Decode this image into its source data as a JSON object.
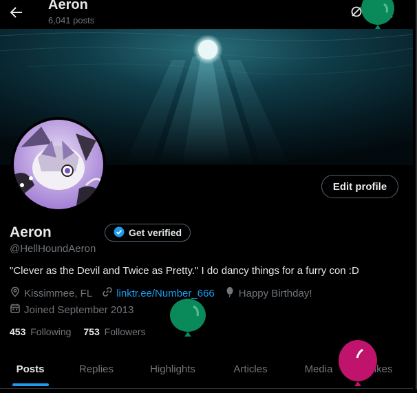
{
  "header": {
    "title": "Aeron",
    "post_count": "6,041 posts"
  },
  "profile": {
    "name": "Aeron",
    "verify_label": "Get verified",
    "handle": "@HellHoundAeron",
    "bio": "\"Clever as the Devil and Twice as Pretty.\" I do dancy things for a furry con :D",
    "location": "Kissimmee, FL",
    "link": "linktr.ee/Number_666",
    "birthday": "Happy Birthday!",
    "joined": "Joined September 2013",
    "edit_label": "Edit profile"
  },
  "stats": {
    "following_count": "453",
    "following_label": "Following",
    "followers_count": "753",
    "followers_label": "Followers"
  },
  "tabs": [
    {
      "label": "Posts"
    },
    {
      "label": "Replies"
    },
    {
      "label": "Highlights"
    },
    {
      "label": "Articles"
    },
    {
      "label": "Media"
    },
    {
      "label": "Likes"
    }
  ],
  "colors": {
    "accent": "#1d9bf0",
    "balloon_green": "#0a8a5a",
    "balloon_magenta": "#c0136c"
  }
}
